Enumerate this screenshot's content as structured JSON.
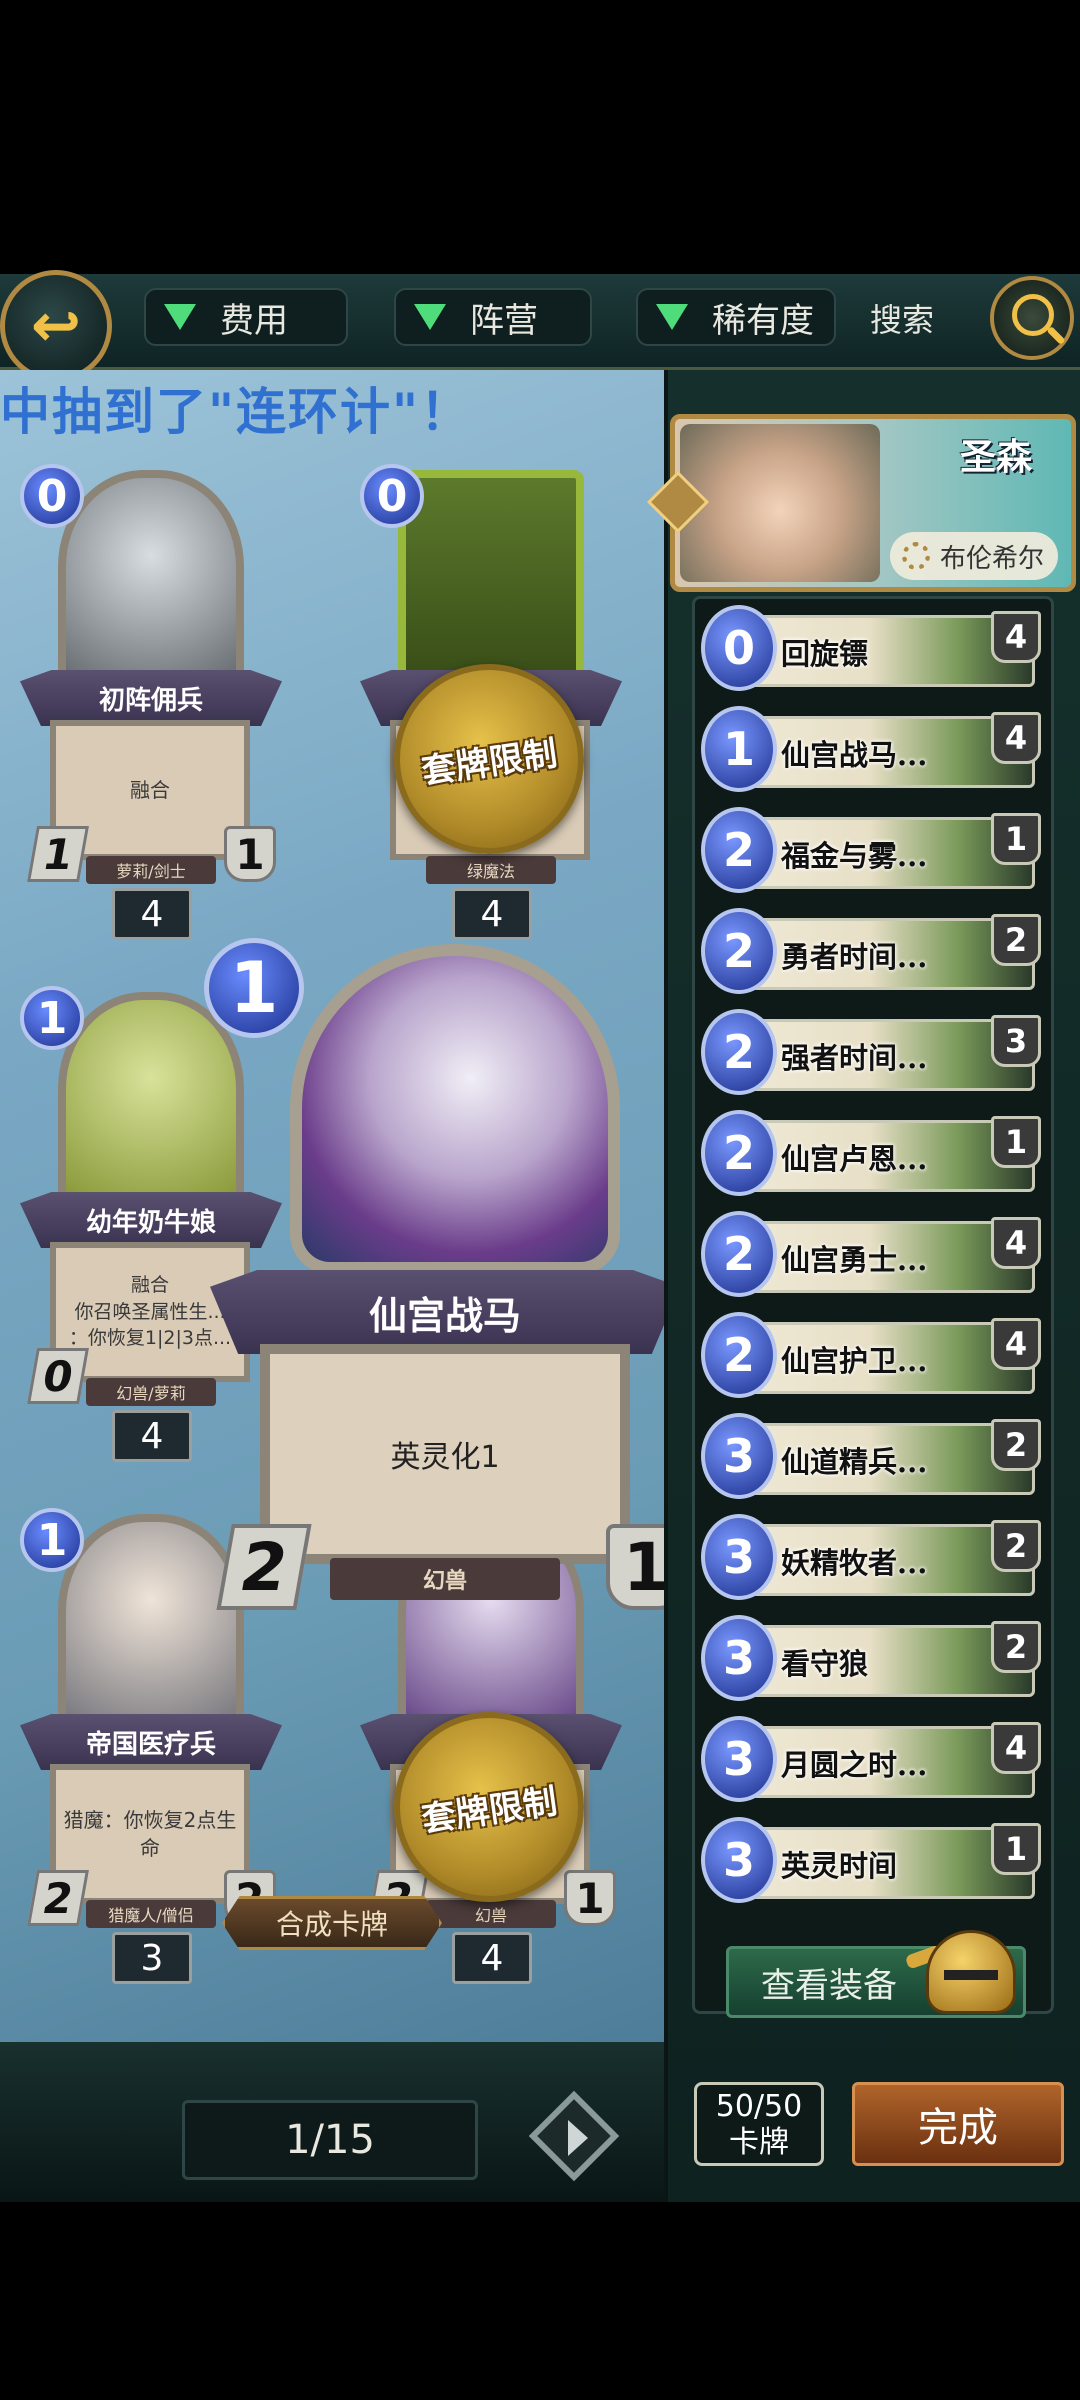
{
  "topbar": {
    "filters": [
      "费用",
      "阵营",
      "稀有度"
    ],
    "search_label": "搜索"
  },
  "banner": "中抽到了\"连环计\"！",
  "cards": [
    {
      "name": "初阵佣兵",
      "cost": "0",
      "text": "融合",
      "tribe": "萝莉/剑士",
      "atk": "1",
      "hp": "1",
      "count": "4",
      "restricted": false
    },
    {
      "name": "",
      "cost": "0",
      "text": "",
      "tribe": "绿魔法",
      "atk": "",
      "hp": "",
      "count": "4",
      "restricted": true
    },
    {
      "name": "幼年奶牛娘",
      "cost": "1",
      "text": "融合\n你召唤圣属性生...\n：你恢复1|2|3点...",
      "tribe": "幻兽/萝莉",
      "atk": "0",
      "hp": "",
      "count": "4",
      "restricted": false
    },
    {
      "name": "帝国医疗兵",
      "cost": "1",
      "text": "猎魔：你恢复2点生命",
      "tribe": "猎魔人/僧侣",
      "atk": "2",
      "hp": "2",
      "count": "3",
      "restricted": false
    },
    {
      "name": "",
      "cost": "",
      "text": "",
      "tribe": "幻兽",
      "atk": "2",
      "hp": "1",
      "count": "4",
      "restricted": true
    }
  ],
  "seal_text": "套牌限制",
  "big_card": {
    "name": "仙宫战马",
    "cost": "1",
    "text": "英灵化1",
    "tribe": "幻兽",
    "atk": "2",
    "hp": "1"
  },
  "synth_button": "合成卡牌",
  "page_indicator": "1/15",
  "leader": {
    "name": "圣森",
    "subtitle": "布伦希尔"
  },
  "deck": [
    {
      "cost": "0",
      "name": "回旋镖",
      "qty": "4"
    },
    {
      "cost": "1",
      "name": "仙宫战马...",
      "qty": "4"
    },
    {
      "cost": "2",
      "name": "福金与雾...",
      "qty": "1"
    },
    {
      "cost": "2",
      "name": "勇者时间...",
      "qty": "2"
    },
    {
      "cost": "2",
      "name": "强者时间...",
      "qty": "3"
    },
    {
      "cost": "2",
      "name": "仙宫卢恩...",
      "qty": "1"
    },
    {
      "cost": "2",
      "name": "仙宫勇士...",
      "qty": "4"
    },
    {
      "cost": "2",
      "name": "仙宫护卫...",
      "qty": "4"
    },
    {
      "cost": "3",
      "name": "仙道精兵...",
      "qty": "2"
    },
    {
      "cost": "3",
      "name": "妖精牧者...",
      "qty": "2"
    },
    {
      "cost": "3",
      "name": "看守狼",
      "qty": "2"
    },
    {
      "cost": "3",
      "name": "月圆之时...",
      "qty": "4"
    },
    {
      "cost": "3",
      "name": "英灵时间",
      "qty": "1"
    }
  ],
  "equip_button": "查看装备",
  "deck_count": {
    "value": "50/50",
    "label": "卡牌"
  },
  "done_button": "完成"
}
